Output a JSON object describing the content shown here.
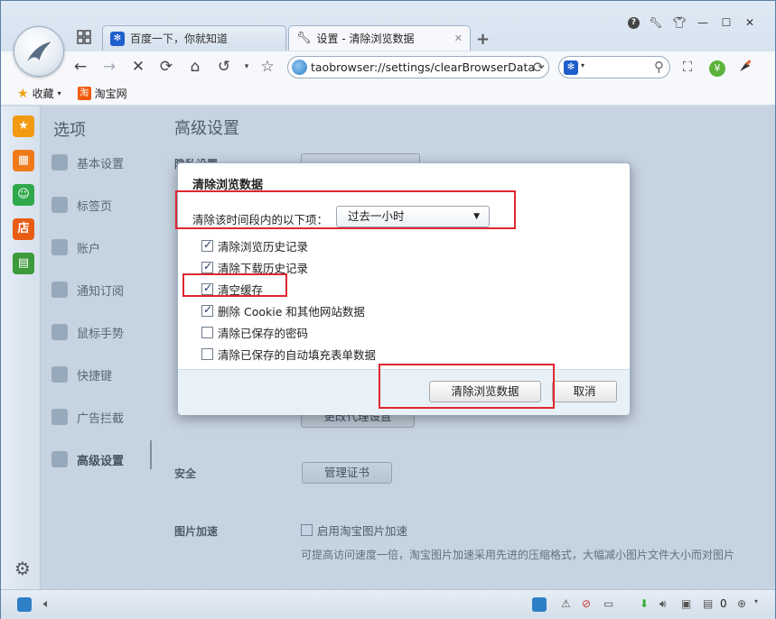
{
  "tabs": [
    {
      "label": "百度一下，你就知道",
      "active": false
    },
    {
      "label": "设置 - 清除浏览数据",
      "active": true
    }
  ],
  "address": {
    "url": "taobrowser://settings/clearBrowserData"
  },
  "bookmarks": [
    {
      "label": "收藏"
    },
    {
      "label": "淘宝网",
      "icon_text": "淘"
    }
  ],
  "apps": [
    {
      "icon": "star-icon",
      "color": "#f29a12"
    },
    {
      "icon": "chart-icon",
      "color": "#f07a1a"
    },
    {
      "icon": "person-icon",
      "color": "#2fa84a"
    },
    {
      "icon": "shop-icon",
      "color": "#e85c14",
      "text": "店"
    },
    {
      "icon": "truck-icon",
      "color": "#3b9a3a"
    }
  ],
  "settings": {
    "nav_title": "选项",
    "page_title": "高级设置",
    "nav": [
      {
        "label": "基本设置"
      },
      {
        "label": "标签页"
      },
      {
        "label": "账户"
      },
      {
        "label": "通知订阅"
      },
      {
        "label": "鼠标手势"
      },
      {
        "label": "快捷键"
      },
      {
        "label": "广告拦截"
      },
      {
        "label": "高级设置",
        "selected": true
      }
    ],
    "partial_label": "隐私设置",
    "proxy_button": "更改代理设置",
    "security_label": "安全",
    "cert_button": "管理证书",
    "image_label": "图片加速",
    "image_option": "启用淘宝图片加速",
    "image_hint": "可提高访问速度一倍，淘宝图片加速采用先进的压缩格式，大幅减小图片文件大小而对图片"
  },
  "dialog": {
    "title": "清除浏览数据",
    "period_label": "清除该时间段内的以下项：",
    "period_value": "过去一小时",
    "options": [
      {
        "label": "清除浏览历史记录",
        "checked": true
      },
      {
        "label": "清除下载历史记录",
        "checked": true
      },
      {
        "label": "清空缓存",
        "checked": true
      },
      {
        "label": "删除 Cookie 和其他网站数据",
        "checked": true
      },
      {
        "label": "清除已保存的密码",
        "checked": false
      },
      {
        "label": "清除已保存的自动填充表单数据",
        "checked": false
      }
    ],
    "confirm_label": "清除浏览数据",
    "cancel_label": "取消"
  },
  "status": {
    "count": "0"
  },
  "colors": {
    "highlight": "#e0262f",
    "accent": "#2f7fc6"
  }
}
